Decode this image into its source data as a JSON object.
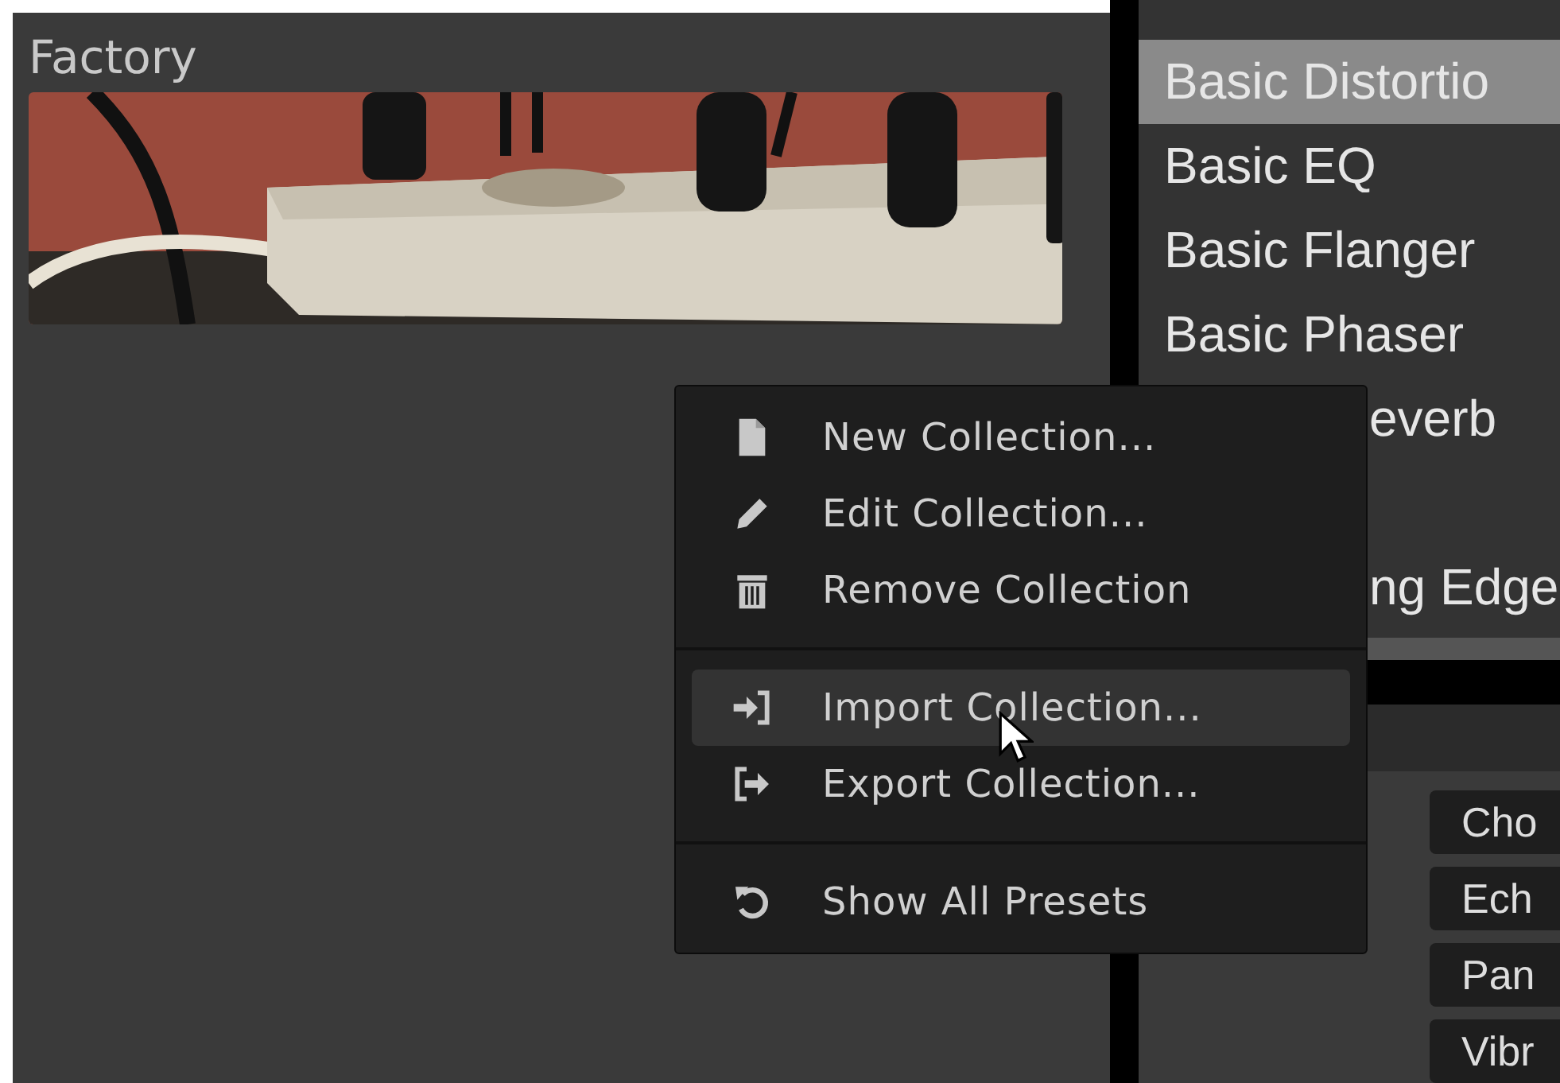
{
  "collection_panel": {
    "title": "Factory"
  },
  "preset_list": {
    "items": [
      {
        "label": "Basic Distortio",
        "selected": true,
        "covered": false
      },
      {
        "label": "Basic EQ",
        "selected": false,
        "covered": false
      },
      {
        "label": "Basic Flanger",
        "selected": false,
        "covered": false
      },
      {
        "label": "Basic Phaser",
        "selected": false,
        "covered": false
      },
      {
        "label": "everb",
        "selected": false,
        "covered": true
      },
      {
        "label": "ng Edge",
        "selected": false,
        "covered": true
      }
    ]
  },
  "tags": [
    "Cho",
    "Ech",
    "Pan",
    "Vibr"
  ],
  "context_menu": {
    "groups": [
      [
        {
          "label": "New Collection...",
          "selected": false
        },
        {
          "label": "Edit Collection...",
          "selected": false
        },
        {
          "label": "Remove Collection",
          "selected": false
        }
      ],
      [
        {
          "label": "Import Collection...",
          "selected": true
        },
        {
          "label": "Export Collection...",
          "selected": false
        }
      ],
      [
        {
          "label": "Show All Presets",
          "selected": false
        }
      ]
    ]
  }
}
